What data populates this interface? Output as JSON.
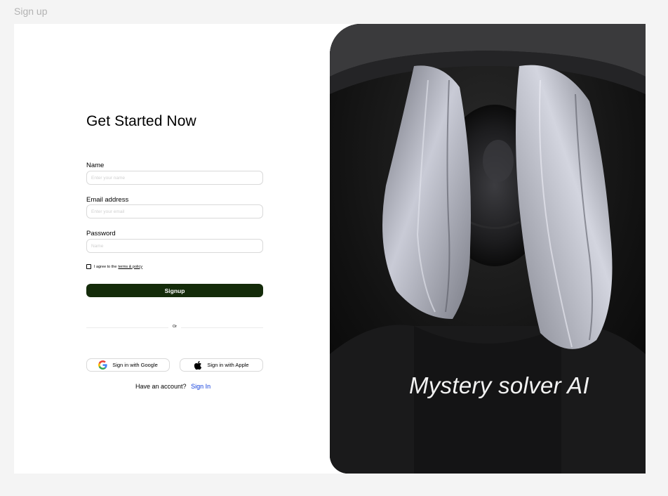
{
  "frame_label": "Sign up",
  "form": {
    "title": "Get Started Now",
    "name": {
      "label": "Name",
      "placeholder": "Enter your name"
    },
    "email": {
      "label": "Email address",
      "placeholder": "Enter your email"
    },
    "password": {
      "label": "Password",
      "placeholder": "Name"
    },
    "agree_text": "I agree to the",
    "terms_link": "terms & policy",
    "signup_label": "Signup",
    "divider_text": "Or",
    "google_label": "Sign in with Google",
    "apple_label": "Sign in with Apple",
    "account_text": "Have an account?",
    "signin_label": "Sign In"
  },
  "hero": {
    "tagline": "Mystery solver AI"
  },
  "colors": {
    "page_background": "#f4f4f4",
    "signup_button": "#142b0a",
    "signin_link": "#0f3ddc"
  }
}
